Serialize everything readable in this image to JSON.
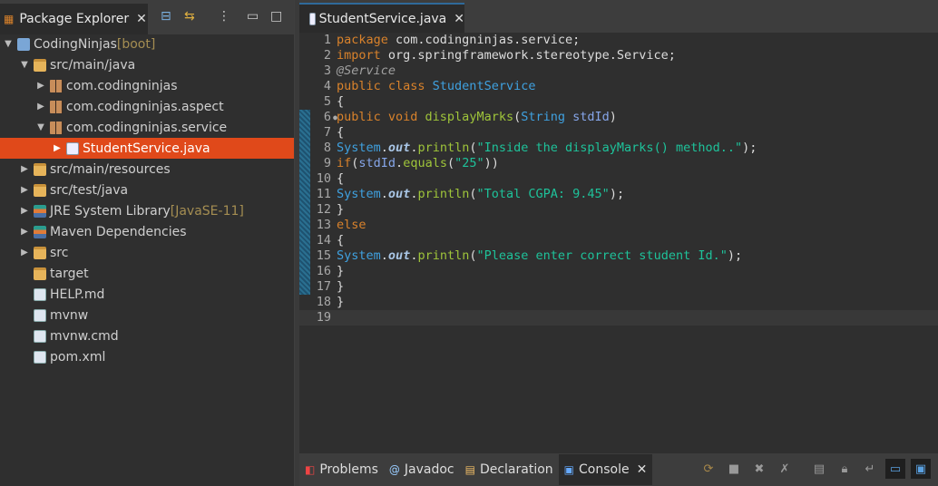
{
  "explorer": {
    "title": "Package Explorer",
    "tools": [
      "collapse-all-icon",
      "link-with-editor-icon",
      "view-menu-icon",
      "minimize-icon",
      "maximize-icon"
    ],
    "items": [
      {
        "label": "CodingNinjas",
        "deco": " [boot]",
        "level": 0,
        "twisty": "open",
        "icon": "proj"
      },
      {
        "label": "src/main/java",
        "level": 1,
        "twisty": "open",
        "icon": "folder"
      },
      {
        "label": "com.codingninjas",
        "level": 2,
        "twisty": "closed",
        "icon": "pkg"
      },
      {
        "label": "com.codingninjas.aspect",
        "level": 2,
        "twisty": "closed",
        "icon": "pkg"
      },
      {
        "label": "com.codingninjas.service",
        "level": 2,
        "twisty": "open",
        "icon": "pkg"
      },
      {
        "label": "StudentService.java",
        "level": 3,
        "twisty": "closed",
        "icon": "java",
        "selected": true
      },
      {
        "label": "src/main/resources",
        "level": 1,
        "twisty": "closed",
        "icon": "folder"
      },
      {
        "label": "src/test/java",
        "level": 1,
        "twisty": "closed",
        "icon": "folder"
      },
      {
        "label": "JRE System Library",
        "deco": " [JavaSE-11]",
        "level": 1,
        "twisty": "closed",
        "icon": "lib"
      },
      {
        "label": "Maven Dependencies",
        "level": 1,
        "twisty": "closed",
        "icon": "lib"
      },
      {
        "label": "src",
        "level": 1,
        "twisty": "closed",
        "icon": "folder"
      },
      {
        "label": "target",
        "level": 1,
        "twisty": "none",
        "icon": "folder"
      },
      {
        "label": "HELP.md",
        "level": 1,
        "twisty": "none",
        "icon": "file"
      },
      {
        "label": "mvnw",
        "level": 1,
        "twisty": "none",
        "icon": "file"
      },
      {
        "label": "mvnw.cmd",
        "level": 1,
        "twisty": "none",
        "icon": "file"
      },
      {
        "label": "pom.xml",
        "level": 1,
        "twisty": "none",
        "icon": "file"
      }
    ]
  },
  "editor": {
    "tab": "StudentService.java",
    "lines": [
      [
        [
          "k",
          "package"
        ],
        [
          "t",
          " com.codingninjas.service;"
        ]
      ],
      [
        [
          "k",
          "import"
        ],
        [
          "t",
          " org.springframework.stereotype.Service;"
        ]
      ],
      [
        [
          "a",
          "@Service"
        ]
      ],
      [
        [
          "k",
          "public class "
        ],
        [
          "c",
          "StudentService"
        ]
      ],
      [
        [
          "t",
          "{"
        ]
      ],
      [
        [
          "k",
          "public void "
        ],
        [
          "m",
          "displayMarks"
        ],
        [
          "t",
          "("
        ],
        [
          "c",
          "String "
        ],
        [
          "v",
          "stdId"
        ],
        [
          "t",
          ")"
        ]
      ],
      [
        [
          "t",
          "{"
        ]
      ],
      [
        [
          "c",
          "System"
        ],
        [
          "t",
          "."
        ],
        [
          "o",
          "out"
        ],
        [
          "t",
          "."
        ],
        [
          "m",
          "println"
        ],
        [
          "t",
          "("
        ],
        [
          "s",
          "\"Inside the displayMarks() method..\""
        ],
        [
          "t",
          ");"
        ]
      ],
      [
        [
          "k",
          "if"
        ],
        [
          "t",
          "("
        ],
        [
          "v",
          "stdId"
        ],
        [
          "t",
          "."
        ],
        [
          "m",
          "equals"
        ],
        [
          "t",
          "("
        ],
        [
          "s",
          "\"25\""
        ],
        [
          "t",
          "))"
        ]
      ],
      [
        [
          "t",
          "{"
        ]
      ],
      [
        [
          "c",
          "System"
        ],
        [
          "t",
          "."
        ],
        [
          "o",
          "out"
        ],
        [
          "t",
          "."
        ],
        [
          "m",
          "println"
        ],
        [
          "t",
          "("
        ],
        [
          "s",
          "\"Total CGPA: 9.45\""
        ],
        [
          "t",
          ");"
        ]
      ],
      [
        [
          "t",
          "}"
        ]
      ],
      [
        [
          "k",
          "else"
        ]
      ],
      [
        [
          "t",
          "{"
        ]
      ],
      [
        [
          "c",
          "System"
        ],
        [
          "t",
          "."
        ],
        [
          "o",
          "out"
        ],
        [
          "t",
          "."
        ],
        [
          "m",
          "println"
        ],
        [
          "t",
          "("
        ],
        [
          "s",
          "\"Please enter correct student Id.\""
        ],
        [
          "t",
          ");"
        ]
      ],
      [
        [
          "t",
          "}"
        ]
      ],
      [
        [
          "t",
          "}"
        ]
      ],
      [
        [
          "t",
          "}"
        ]
      ],
      []
    ]
  },
  "bottom": {
    "tabs": [
      {
        "label": "Problems",
        "icon": "problems-icon"
      },
      {
        "label": "Javadoc",
        "icon": "at-icon"
      },
      {
        "label": "Declaration",
        "icon": "declaration-icon"
      },
      {
        "label": "Console",
        "icon": "console-icon",
        "active": true
      }
    ],
    "tools": [
      "sync-icon",
      "stop-icon",
      "remove-icon",
      "remove-all-icon",
      "clear-console-icon",
      "scroll-lock-icon",
      "word-wrap-icon",
      "pin-console-icon",
      "display-console-icon"
    ]
  }
}
